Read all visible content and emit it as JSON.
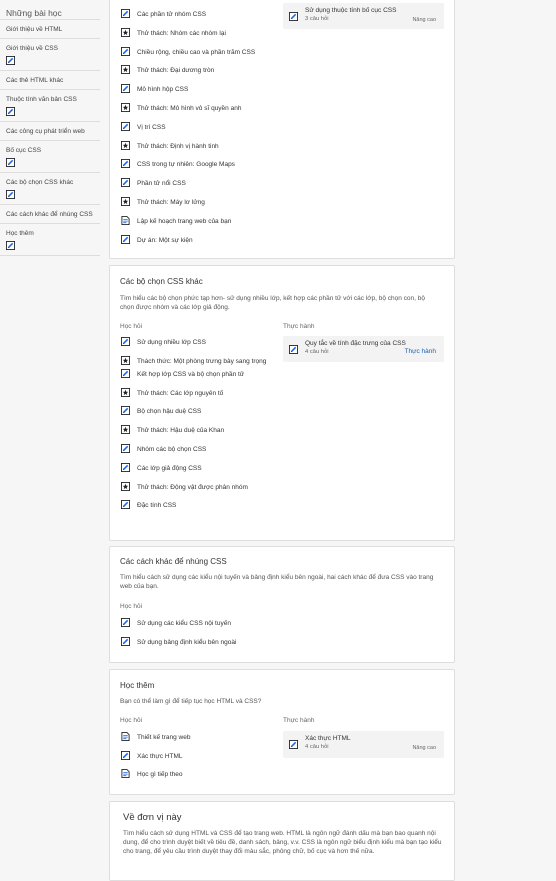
{
  "sidebar": {
    "title": "Những bài học",
    "items": [
      {
        "label": "Giới thiệu về HTML",
        "icon": ""
      },
      {
        "label": "Giới thiệu về CSS",
        "icon": "edit-doc-icon"
      },
      {
        "label": "Các thẻ HTML khác",
        "icon": ""
      },
      {
        "label": "Thuộc tính văn bản CSS",
        "icon": "edit-doc-icon"
      },
      {
        "label": "Các công cụ phát triển web",
        "icon": ""
      },
      {
        "label": "Bố cục CSS",
        "icon": "edit-doc-icon"
      },
      {
        "label": "Các bộ chọn CSS khác",
        "icon": "edit-doc-icon"
      },
      {
        "label": "Các cách khác để nhúng CSS",
        "icon": ""
      },
      {
        "label": "Học thêm",
        "icon": "edit-doc-icon"
      }
    ]
  },
  "top_card": {
    "lessons": [
      {
        "label": "Các phần tử nhóm CSS",
        "icon": "edit-doc-icon"
      },
      {
        "label": "Thử thách: Nhóm các nhóm lại",
        "icon": "star-doc-icon"
      },
      {
        "label": "Chiều rộng, chiều cao và phần trăm CSS",
        "icon": "edit-doc-icon"
      },
      {
        "label": "Thử thách: Đại dương tròn",
        "icon": "star-doc-icon"
      },
      {
        "label": "Mô hình hộp CSS",
        "icon": "edit-doc-icon"
      },
      {
        "label": "Thử thách: Mô hình vô sĩ quyền anh",
        "icon": "star-doc-icon"
      },
      {
        "label": "Vị trí CSS",
        "icon": "edit-doc-icon"
      },
      {
        "label": "Thử thách: Định vị hành tinh",
        "icon": "star-doc-icon"
      },
      {
        "label": "CSS trong tự nhiên: Google Maps",
        "icon": "edit-doc-icon"
      },
      {
        "label": "Phần tử nổi CSS",
        "icon": "edit-doc-icon"
      },
      {
        "label": "Thử thách: Máy lơ lửng",
        "icon": "star-doc-icon"
      },
      {
        "label": "Lập kế hoạch trang web của bạn",
        "icon": "text-doc-icon"
      },
      {
        "label": "Dự án: Một sự kiện",
        "icon": "edit-doc-icon"
      }
    ],
    "practice": {
      "title": "Sử dụng thuộc tính bố cục CSS",
      "sub": "3 câu hỏi",
      "tag": "Nâng cao"
    }
  },
  "selectors_card": {
    "title": "Các bộ chọn CSS khác",
    "desc": "Tìm hiểu các bộ chọn phức tạp hơn- sử dụng nhiều lớp, kết hợp các phần tử với các lớp, bộ chọn con, bộ chọn được nhóm và các lớp giả động.",
    "learn_head": "Học hỏi",
    "practice_head": "Thực hành",
    "lessons": [
      {
        "label": "Sử dụng nhiều lớp CSS",
        "icon": "edit-doc-icon"
      },
      {
        "label": "Thách thức: Một phòng trưng bày sang trọng",
        "icon": "star-doc-icon"
      },
      {
        "label": "Kết hợp lớp CSS và bộ chọn phần tử",
        "icon": "edit-doc-icon"
      },
      {
        "label": "Thử thách: Các lớp nguyên tố",
        "icon": "star-doc-icon"
      },
      {
        "label": "Bộ chọn hậu duệ CSS",
        "icon": "edit-doc-icon"
      },
      {
        "label": "Thử thách: Hậu duệ của Khan",
        "icon": "star-doc-icon"
      },
      {
        "label": "Nhóm các bộ chọn CSS",
        "icon": "edit-doc-icon"
      },
      {
        "label": "Các lớp giả động CSS",
        "icon": "edit-doc-icon"
      },
      {
        "label": "Thử thách: Động vật được phân nhóm",
        "icon": "star-doc-icon"
      },
      {
        "label": "Đặc tính CSS",
        "icon": "edit-doc-icon"
      }
    ],
    "practice": {
      "title": "Quy tắc về tính đặc trưng của CSS",
      "sub": "4 câu hỏi",
      "link": "Thực hành"
    }
  },
  "embed_card": {
    "title": "Các cách khác để nhúng CSS",
    "desc": "Tìm hiểu cách sử dụng các kiểu nội tuyến và bảng định kiểu bên ngoài, hai cách khác để đưa CSS vào trang web của bạn.",
    "learn_head": "Học hỏi",
    "lessons": [
      {
        "label": "Sử dụng các kiểu CSS nội tuyến",
        "icon": "edit-doc-icon"
      },
      {
        "label": "Sử dụng bảng định kiểu bên ngoài",
        "icon": "edit-doc-icon"
      }
    ]
  },
  "more_card": {
    "title": "Học thêm",
    "desc": "Bạn có thể làm gì để tiếp tục học HTML và CSS?",
    "learn_head": "Học hỏi",
    "practice_head": "Thực hành",
    "lessons": [
      {
        "label": "Thiết kế trang web",
        "icon": "text-doc-icon"
      },
      {
        "label": "Xác thực HTML",
        "icon": "edit-doc-icon"
      },
      {
        "label": "Học gì tiếp theo",
        "icon": "text-doc-icon"
      }
    ],
    "practice": {
      "title": "Xác thực HTML",
      "sub": "4 câu hỏi",
      "tag": "Nâng cao"
    }
  },
  "about_card": {
    "title": "Về đơn vị này",
    "desc": "Tìm hiểu cách sử dụng HTML và CSS để tạo trang web. HTML là ngôn ngữ đánh dấu mà bạn bao quanh nội dung, để cho trình duyệt biết về tiêu đề, danh sách, bảng, v.v. CSS là ngôn ngữ biểu định kiểu mà bạn tạo kiểu cho trang, để yêu cầu trình duyệt thay đổi màu sắc, phông chữ, bố cục và hơn thế nữa."
  },
  "colors": {
    "accent": "#1a5fb4",
    "icon_dark": "#21242c",
    "icon_blue": "#1865f2"
  }
}
